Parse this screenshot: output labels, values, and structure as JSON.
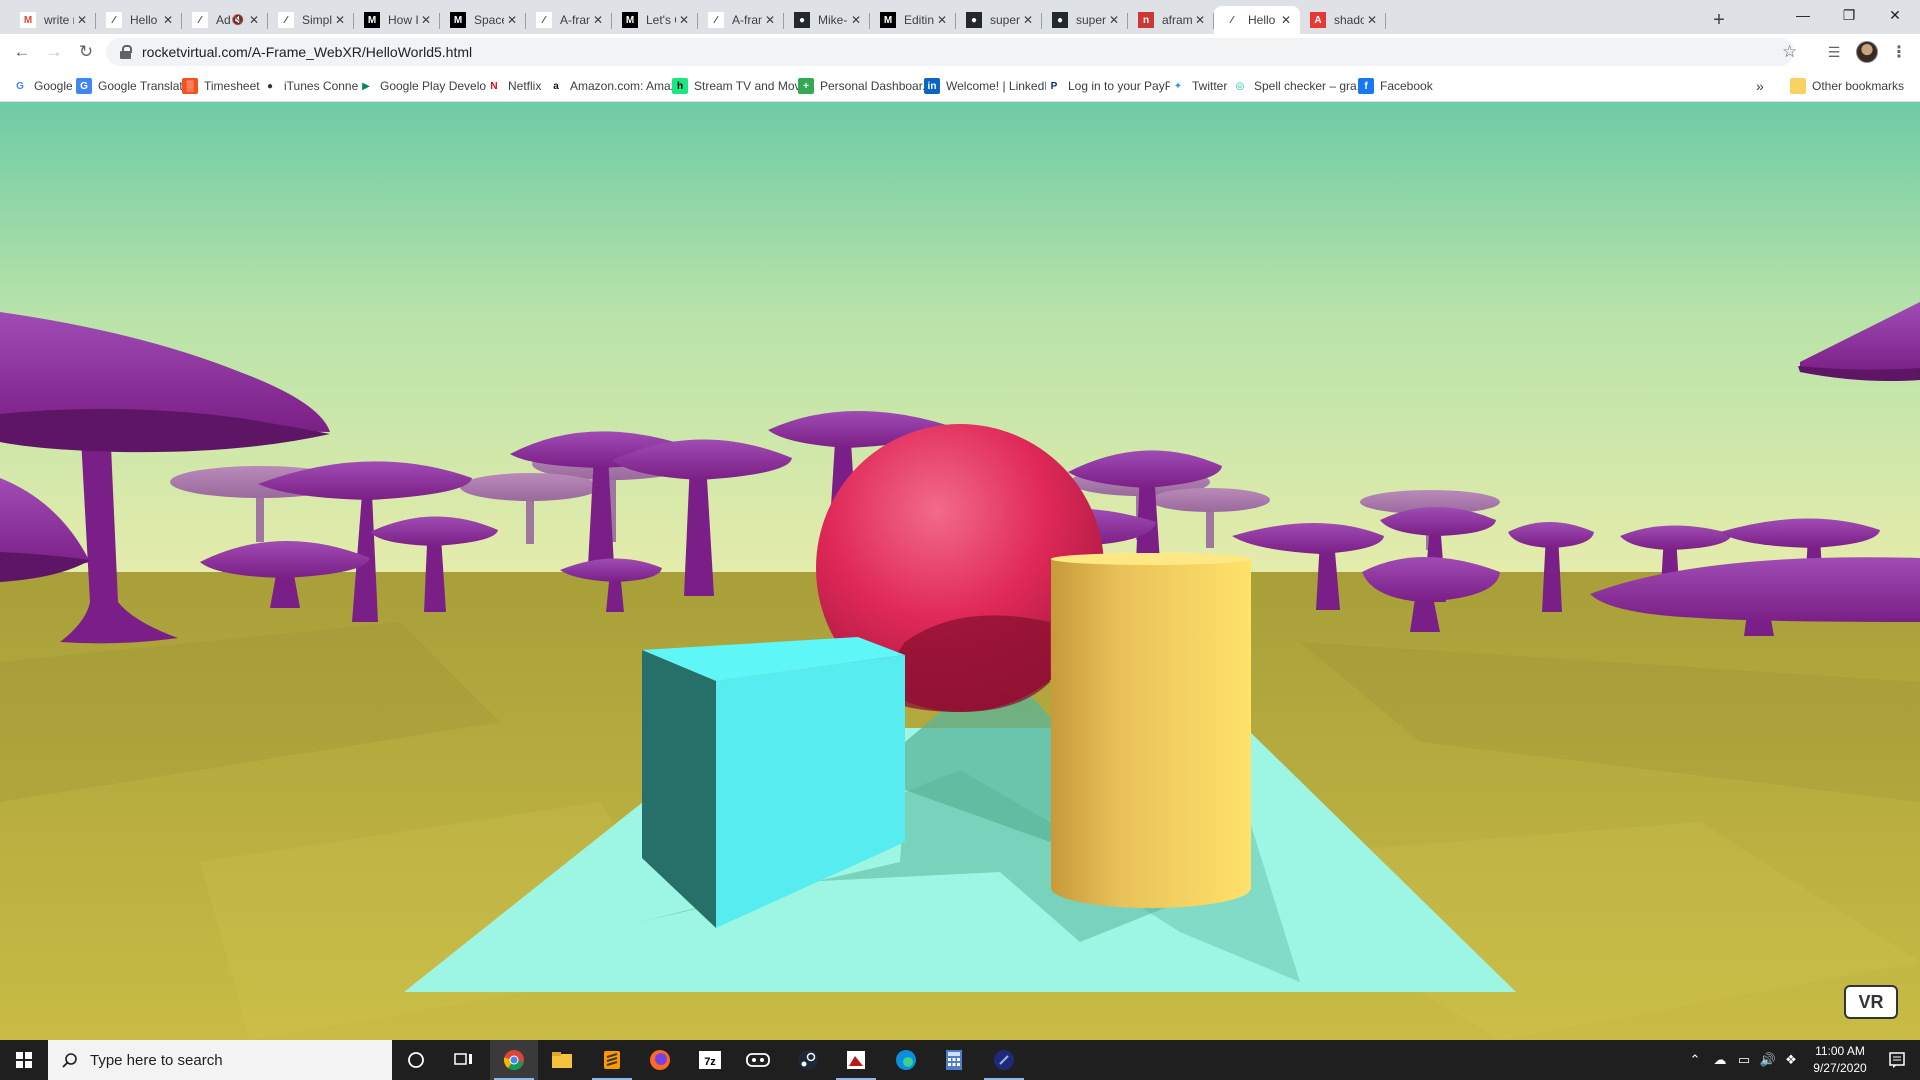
{
  "browser": {
    "tabs": [
      {
        "title": "write ne",
        "favicon": "gmail-icon",
        "active": false
      },
      {
        "title": "Hello W",
        "favicon": "aframe-icon",
        "active": false
      },
      {
        "title": "Adv",
        "favicon": "aframe-icon",
        "active": false,
        "muted": true
      },
      {
        "title": "Simple",
        "favicon": "aframe-icon",
        "active": false
      },
      {
        "title": "How I M",
        "favicon": "medium-icon",
        "active": false
      },
      {
        "title": "Space C",
        "favicon": "medium-icon",
        "active": false
      },
      {
        "title": "A-frame",
        "favicon": "aframe-icon",
        "active": false
      },
      {
        "title": "Let's Co",
        "favicon": "medium-icon",
        "active": false
      },
      {
        "title": "A-fram",
        "favicon": "aframe-icon",
        "active": false
      },
      {
        "title": "Mike-M",
        "favicon": "github-icon",
        "active": false
      },
      {
        "title": "Editing",
        "favicon": "medium-icon",
        "active": false
      },
      {
        "title": "superm",
        "favicon": "github-icon",
        "active": false
      },
      {
        "title": "superm",
        "favicon": "github-icon",
        "active": false
      },
      {
        "title": "aframe",
        "favicon": "npm-icon",
        "active": false
      },
      {
        "title": "Hello W",
        "favicon": "aframe-icon",
        "active": true
      },
      {
        "title": "shadow",
        "favicon": "acrobat-icon",
        "active": false
      }
    ],
    "new_tab_label": "+",
    "address": "rocketvirtual.com/A-Frame_WebXR/HelloWorld5.html",
    "bookmarks": [
      {
        "label": "Google",
        "icon": "google-icon"
      },
      {
        "label": "Google Translate",
        "icon": "translate-icon"
      },
      {
        "label": "Timesheet",
        "icon": "grid-icon"
      },
      {
        "label": "iTunes Connect",
        "icon": "apple-icon"
      },
      {
        "label": "Google Play Develo...",
        "icon": "play-icon"
      },
      {
        "label": "Netflix",
        "icon": "netflix-icon"
      },
      {
        "label": "Amazon.com: Amaz...",
        "icon": "amazon-icon"
      },
      {
        "label": "Stream TV and Mov...",
        "icon": "hulu-icon"
      },
      {
        "label": "Personal Dashboar...",
        "icon": "plus-icon"
      },
      {
        "label": "Welcome! | LinkedIn",
        "icon": "linkedin-icon"
      },
      {
        "label": "Log in to your PayP...",
        "icon": "paypal-icon"
      },
      {
        "label": "Twitter",
        "icon": "twitter-icon"
      },
      {
        "label": "Spell checker – gra...",
        "icon": "grammarly-icon"
      },
      {
        "label": "Facebook",
        "icon": "facebook-icon"
      }
    ],
    "overflow_label": "»",
    "other_bookmarks_label": "Other bookmarks"
  },
  "scene": {
    "vr_button_label": "VR",
    "colors": {
      "sky_top": "#6ecba6",
      "sky_bottom": "#e6ecab",
      "ground": "#c2b643",
      "plane": "#9df6e3",
      "box": "#4cc3d9",
      "sphere": "#ef2d5e",
      "cylinder": "#ffc65d",
      "mushroom": "#8e2d9e"
    }
  },
  "taskbar": {
    "search_placeholder": "Type here to search",
    "time": "11:00 AM",
    "date": "9/27/2020"
  }
}
